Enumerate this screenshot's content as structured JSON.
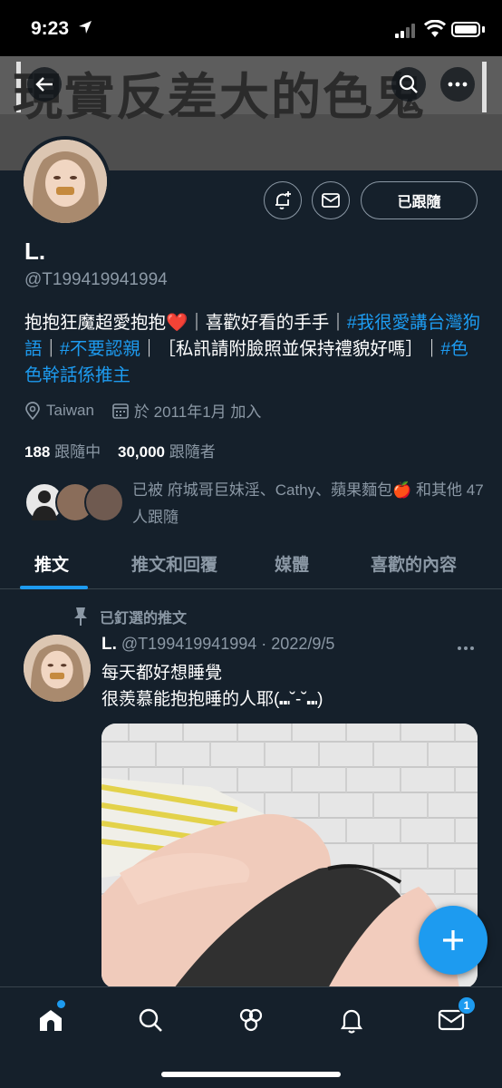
{
  "status_bar": {
    "time": "9:23"
  },
  "banner": {
    "watermark_text": "現實反差大的色鬼"
  },
  "profile": {
    "display_name": "L.",
    "handle": "@T199419941994",
    "following_button": "已跟隨",
    "bio": {
      "line1_a": "抱抱狂魔超愛抱抱",
      "heart": "❤️",
      "line1_b": "｜喜歡好看的手手｜",
      "hashtag1": "#我很愛講台灣狗語",
      "sep1": "｜",
      "hashtag2": "#不要認親",
      "sep2": "｜［私訊請附臉照並保持禮貌好嗎］｜",
      "hashtag3": "#色色幹話係推主"
    },
    "location": "Taiwan",
    "joined": "於 2011年1月 加入",
    "following_count": "188",
    "following_label": "跟隨中",
    "followers_count": "30,000",
    "followers_label": "跟隨者",
    "followed_by": "已被 府城哥巨妹淫、Cathy、蘋果麵包🍎 和其他 47 人跟隨"
  },
  "tabs": [
    {
      "label": "推文",
      "active": true
    },
    {
      "label": "推文和回覆",
      "active": false
    },
    {
      "label": "媒體",
      "active": false
    },
    {
      "label": "喜歡的內容",
      "active": false
    }
  ],
  "pinned_tweet": {
    "pinned_label": "已釘選的推文",
    "name": "L.",
    "handle_date": "@T199419941994 · 2022/9/5",
    "text_line1": "每天都好想睡覺",
    "text_line2": "很羨慕能抱抱睡的人耶(⑉˘-˘⑉)"
  },
  "bottom_nav": {
    "messages_badge": "1"
  },
  "colors": {
    "accent": "#1d9bf0",
    "background": "#15202b",
    "secondary_text": "#8b98a5"
  }
}
